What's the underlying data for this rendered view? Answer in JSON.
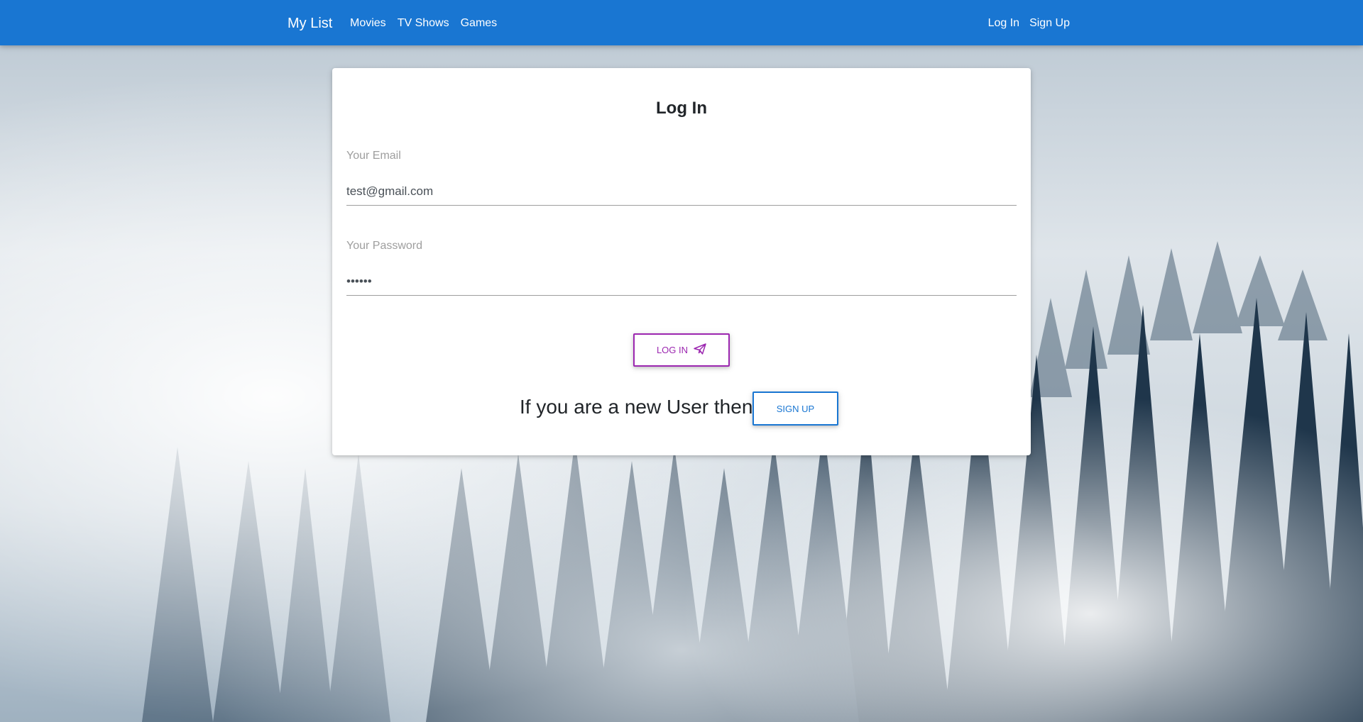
{
  "navbar": {
    "brand": "My List",
    "links": [
      "Movies",
      "TV Shows",
      "Games"
    ],
    "auth_links": [
      "Log In",
      "Sign Up"
    ],
    "color": "#1976d2"
  },
  "login_card": {
    "title": "Log In",
    "email": {
      "label": "Your Email",
      "value": "test@gmail.com"
    },
    "password": {
      "label": "Your Password",
      "value": "••••••"
    },
    "login_button": {
      "label": "LOG IN",
      "icon": "paper-plane-icon",
      "color": "#9c27b0"
    },
    "new_user_text": "If you are a new User then",
    "signup_button": {
      "label": "SIGN UP",
      "color": "#1976d2"
    }
  },
  "background": {
    "description_icon": "foggy-forest-background"
  }
}
